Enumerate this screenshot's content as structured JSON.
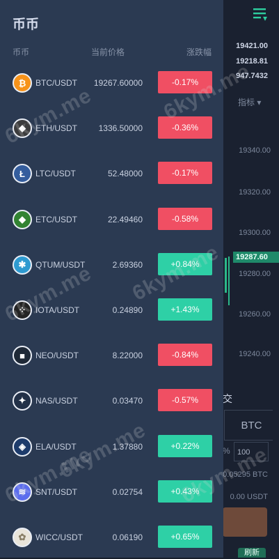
{
  "drawer": {
    "title": "币币",
    "headers": {
      "pair": "币币",
      "price": "当前价格",
      "change": "涨跌幅"
    },
    "rows": [
      {
        "pair": "BTC/USDT",
        "price": "19267.60000",
        "change": "-0.17%",
        "direction": "down",
        "icon": "bitcoin-icon",
        "icon_color": "#f7931a",
        "glyph": "₿"
      },
      {
        "pair": "ETH/USDT",
        "price": "1336.50000",
        "change": "-0.36%",
        "direction": "down",
        "icon": "ethereum-icon",
        "icon_color": "#3c3c3d",
        "glyph": "◆"
      },
      {
        "pair": "LTC/USDT",
        "price": "52.48000",
        "change": "-0.17%",
        "direction": "down",
        "icon": "litecoin-icon",
        "icon_color": "#345d9d",
        "glyph": "Ł"
      },
      {
        "pair": "ETC/USDT",
        "price": "22.49460",
        "change": "-0.58%",
        "direction": "down",
        "icon": "ethereum-classic-icon",
        "icon_color": "#328332",
        "glyph": "◆"
      },
      {
        "pair": "QTUM/USDT",
        "price": "2.69360",
        "change": "+0.84%",
        "direction": "up",
        "icon": "qtum-icon",
        "icon_color": "#2e9ad0",
        "glyph": "✱"
      },
      {
        "pair": "IOTA/USDT",
        "price": "0.24890",
        "change": "+1.43%",
        "direction": "up",
        "icon": "iota-icon",
        "icon_color": "#242424",
        "glyph": "⁘"
      },
      {
        "pair": "NEO/USDT",
        "price": "8.22000",
        "change": "-0.84%",
        "direction": "down",
        "icon": "neo-icon",
        "icon_color": "#1f2937",
        "glyph": "■"
      },
      {
        "pair": "NAS/USDT",
        "price": "0.03470",
        "change": "-0.57%",
        "direction": "down",
        "icon": "nas-icon",
        "icon_color": "#223047",
        "glyph": "✦"
      },
      {
        "pair": "ELA/USDT",
        "price": "1.37880",
        "change": "+0.22%",
        "direction": "up",
        "icon": "ela-icon",
        "icon_color": "#1d3b6b",
        "glyph": "◈"
      },
      {
        "pair": "SNT/USDT",
        "price": "0.02754",
        "change": "+0.43%",
        "direction": "up",
        "icon": "snt-icon",
        "icon_color": "#5b6dee",
        "glyph": "≋"
      },
      {
        "pair": "WICC/USDT",
        "price": "0.06190",
        "change": "+0.65%",
        "direction": "up",
        "icon": "wicc-icon",
        "icon_color": "#e9e4d9",
        "glyph": "✿"
      }
    ]
  },
  "background": {
    "prices": [
      "19421.00",
      "19218.81",
      "947.7432"
    ],
    "indicator": "指标",
    "axis_ticks": [
      "19340.00",
      "19320.00",
      "19300.00",
      "19280.00",
      "19260.00",
      "19240.00"
    ],
    "last_price_tag": "19287.60",
    "trade_label": "交",
    "btc_label": "BTC",
    "pct_label": "%",
    "amount_value": "100",
    "balance_btc": "0.05295 BTC",
    "balance_usdt": "0.00 USDT",
    "refresh_label": "刷新"
  },
  "watermark": "6kym.me",
  "colors": {
    "drawer_bg": "#2b3a52",
    "up": "#2ed0a6",
    "down": "#f04f63",
    "page_bg": "#171e2c"
  }
}
